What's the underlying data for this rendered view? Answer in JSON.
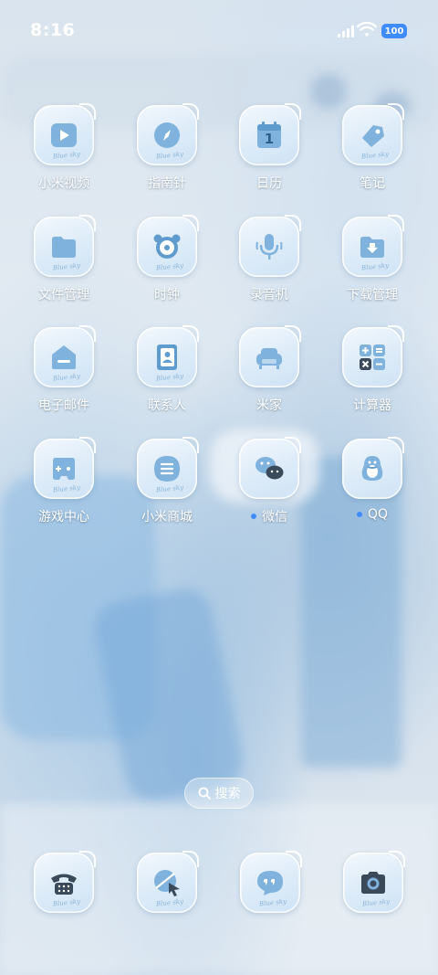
{
  "status_bar": {
    "time": "8:16",
    "battery_level": "100",
    "battery_color": "#3f8cff"
  },
  "apps": [
    {
      "label": "小米视频",
      "icon": "play-icon",
      "has_dot": false
    },
    {
      "label": "指南针",
      "icon": "compass-icon",
      "has_dot": false
    },
    {
      "label": "日历",
      "icon": "calendar-icon",
      "has_dot": false,
      "date": "1"
    },
    {
      "label": "笔记",
      "icon": "note-tag-icon",
      "has_dot": false
    },
    {
      "label": "文件管理",
      "icon": "folder-icon",
      "has_dot": false
    },
    {
      "label": "时钟",
      "icon": "alarm-clock-icon",
      "has_dot": false
    },
    {
      "label": "录音机",
      "icon": "microphone-icon",
      "has_dot": false
    },
    {
      "label": "下载管理",
      "icon": "download-icon",
      "has_dot": false
    },
    {
      "label": "电子邮件",
      "icon": "mail-icon",
      "has_dot": false
    },
    {
      "label": "联系人",
      "icon": "contacts-book-icon",
      "has_dot": false
    },
    {
      "label": "米家",
      "icon": "sofa-icon",
      "has_dot": false
    },
    {
      "label": "计算器",
      "icon": "calculator-icon",
      "has_dot": false
    },
    {
      "label": "游戏中心",
      "icon": "gamepad-icon",
      "has_dot": false
    },
    {
      "label": "小米商城",
      "icon": "menu-icon",
      "has_dot": false
    },
    {
      "label": "微信",
      "icon": "wechat-icon",
      "has_dot": true
    },
    {
      "label": "QQ",
      "icon": "penguin-icon",
      "has_dot": true
    }
  ],
  "icon_tag": "Blue sky",
  "search": {
    "label": "搜索",
    "icon": "search-icon"
  },
  "dock": [
    {
      "icon": "phone-icon"
    },
    {
      "icon": "browser-icon"
    },
    {
      "icon": "message-icon"
    },
    {
      "icon": "camera-icon"
    }
  ],
  "colors": {
    "icon_glyph": "#7fb2dc",
    "new_dot": "#3f8cff",
    "label_text": "#ffffff"
  }
}
